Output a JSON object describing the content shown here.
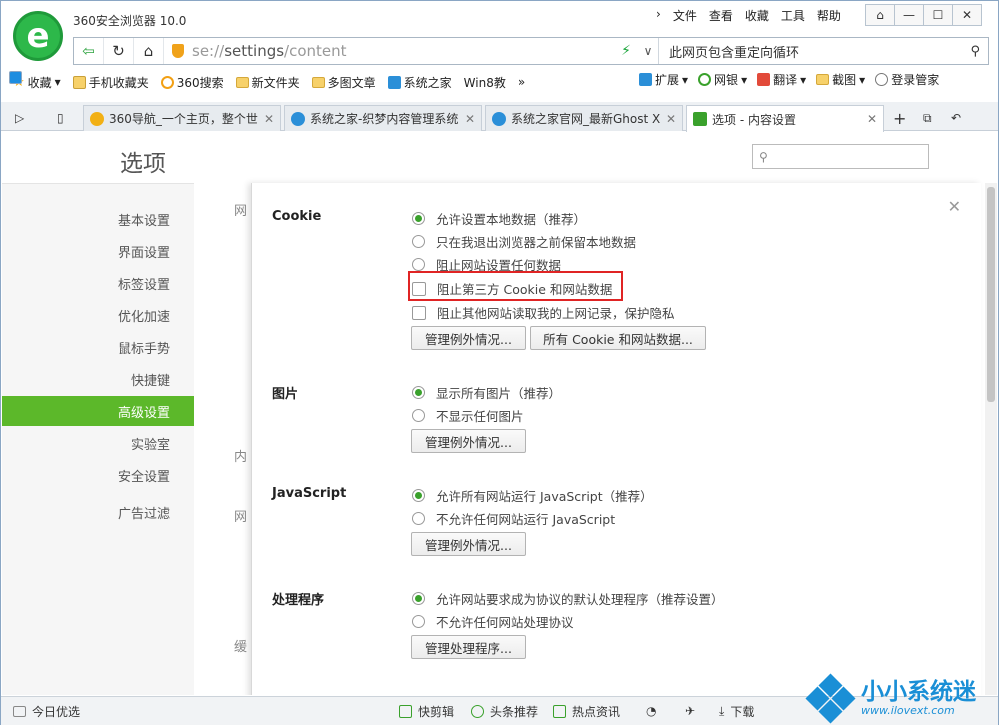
{
  "app": {
    "title": "360安全浏览器 10.0",
    "logo_letter": "e",
    "menu": [
      "文件",
      "查看",
      "收藏",
      "工具",
      "帮助"
    ],
    "window_buttons": [
      "⌂",
      "—",
      "☐",
      "✕"
    ]
  },
  "address": {
    "url_scheme": "se://",
    "url_host": "settings",
    "url_path": "/content",
    "search_text": "此网页包含重定向循环"
  },
  "bookmarks": {
    "left": [
      {
        "icon": "star-icon",
        "label": "收藏"
      },
      {
        "icon": "phone-icon",
        "label": "手机收藏夹"
      },
      {
        "icon": "360-icon",
        "label": "360搜索"
      },
      {
        "icon": "folder-icon",
        "label": "新文件夹"
      },
      {
        "icon": "folder-icon",
        "label": "多图文章"
      },
      {
        "icon": "site-icon",
        "label": "系统之家"
      },
      {
        "icon": "windows-icon",
        "label": "Win8教"
      }
    ],
    "more": "»",
    "right": [
      "扩展",
      "网银",
      "翻译",
      "截图",
      "登录管家"
    ]
  },
  "tabs": [
    {
      "label": "360导航_一个主页，整个世",
      "icon": "360-icon"
    },
    {
      "label": "系统之家-织梦内容管理系统",
      "icon": "site-icon"
    },
    {
      "label": "系统之家官网_最新Ghost X",
      "icon": "site-icon"
    },
    {
      "label": "选项 - 内容设置",
      "icon": "wrench-icon",
      "active": true
    }
  ],
  "page": {
    "title": "选项",
    "search_placeholder": ""
  },
  "sidebar": [
    "基本设置",
    "界面设置",
    "标签设置",
    "优化加速",
    "鼠标手势",
    "快捷键",
    "高级设置",
    "实验室",
    "安全设置",
    "广告过滤"
  ],
  "sidebar_active": "高级设置",
  "background_labels": [
    "网",
    "内",
    "网",
    "缓"
  ],
  "dialog": {
    "cookie": {
      "title": "Cookie",
      "options": [
        "允许设置本地数据（推荐）",
        "只在我退出浏览器之前保留本地数据",
        "阻止网站设置任何数据"
      ],
      "checks": [
        "阻止第三方 Cookie 和网站数据",
        "阻止其他网站读取我的上网记录，保护隐私"
      ],
      "buttons": [
        "管理例外情况...",
        "所有 Cookie 和网站数据..."
      ]
    },
    "images": {
      "title": "图片",
      "options": [
        "显示所有图片（推荐）",
        "不显示任何图片"
      ],
      "button": "管理例外情况..."
    },
    "js": {
      "title": "JavaScript",
      "options": [
        "允许所有网站运行 JavaScript（推荐）",
        "不允许任何网站运行 JavaScript"
      ],
      "button": "管理例外情况..."
    },
    "handlers": {
      "title": "处理程序",
      "options": [
        "允许网站要求成为协议的默认处理程序（推荐设置）",
        "不允许任何网站处理协议"
      ],
      "button": "管理处理程序..."
    }
  },
  "status": {
    "today": "今日优选",
    "items": [
      "快剪辑",
      "头条推荐",
      "热点资讯",
      "下载"
    ]
  },
  "watermark": {
    "name": "小小系统迷",
    "site": "www.ilovext.com"
  },
  "colors": {
    "accent": "#5cb82a",
    "highlight": "#e02424",
    "brand_green": "#2db84a"
  }
}
